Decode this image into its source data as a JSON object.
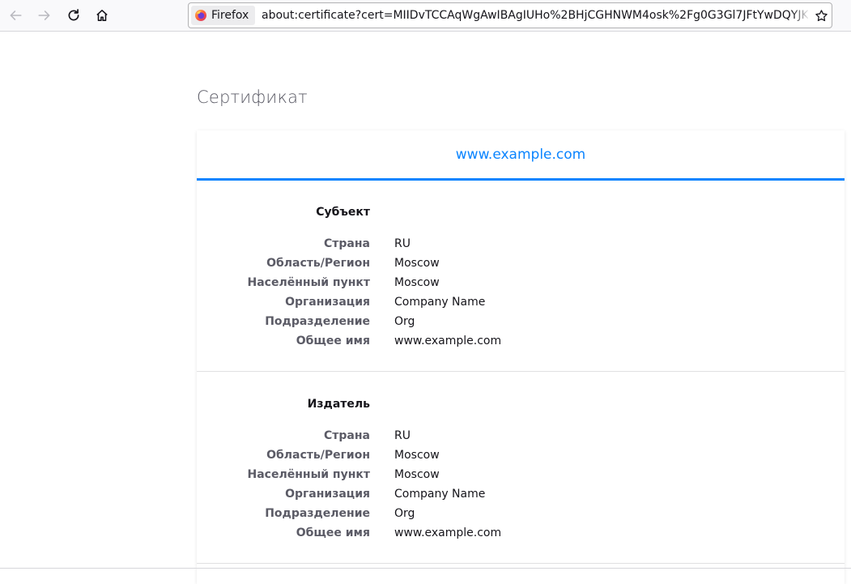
{
  "browser": {
    "identity_label": "Firefox",
    "url": "about:certificate?cert=MIIDvTCCAqWgAwIBAgIUHo%2BHjCGHNWM4osk%2Fg0G3Gl7JFtYwDQYJKoZIhvcNAQEL"
  },
  "icons": {
    "back": "arrow-left-icon",
    "forward": "arrow-right-icon",
    "reload": "reload-icon",
    "home": "home-icon",
    "bookmark": "star-icon",
    "brand": "firefox-logo-icon"
  },
  "colors": {
    "accent": "#0a84ff",
    "label": "#5b5b66"
  },
  "page": {
    "title": "Сертификат",
    "tab": "www.example.com",
    "sections": [
      {
        "title": "Субъект",
        "rows": [
          {
            "key": "Страна",
            "value": "RU"
          },
          {
            "key": "Область/Регион",
            "value": "Moscow"
          },
          {
            "key": "Населённый пункт",
            "value": "Moscow"
          },
          {
            "key": "Организация",
            "value": "Company Name"
          },
          {
            "key": "Подразделение",
            "value": "Org"
          },
          {
            "key": "Общее имя",
            "value": "www.example.com"
          }
        ]
      },
      {
        "title": "Издатель",
        "rows": [
          {
            "key": "Страна",
            "value": "RU"
          },
          {
            "key": "Область/Регион",
            "value": "Moscow"
          },
          {
            "key": "Населённый пункт",
            "value": "Moscow"
          },
          {
            "key": "Организация",
            "value": "Company Name"
          },
          {
            "key": "Подразделение",
            "value": "Org"
          },
          {
            "key": "Общее имя",
            "value": "www.example.com"
          }
        ]
      }
    ]
  }
}
